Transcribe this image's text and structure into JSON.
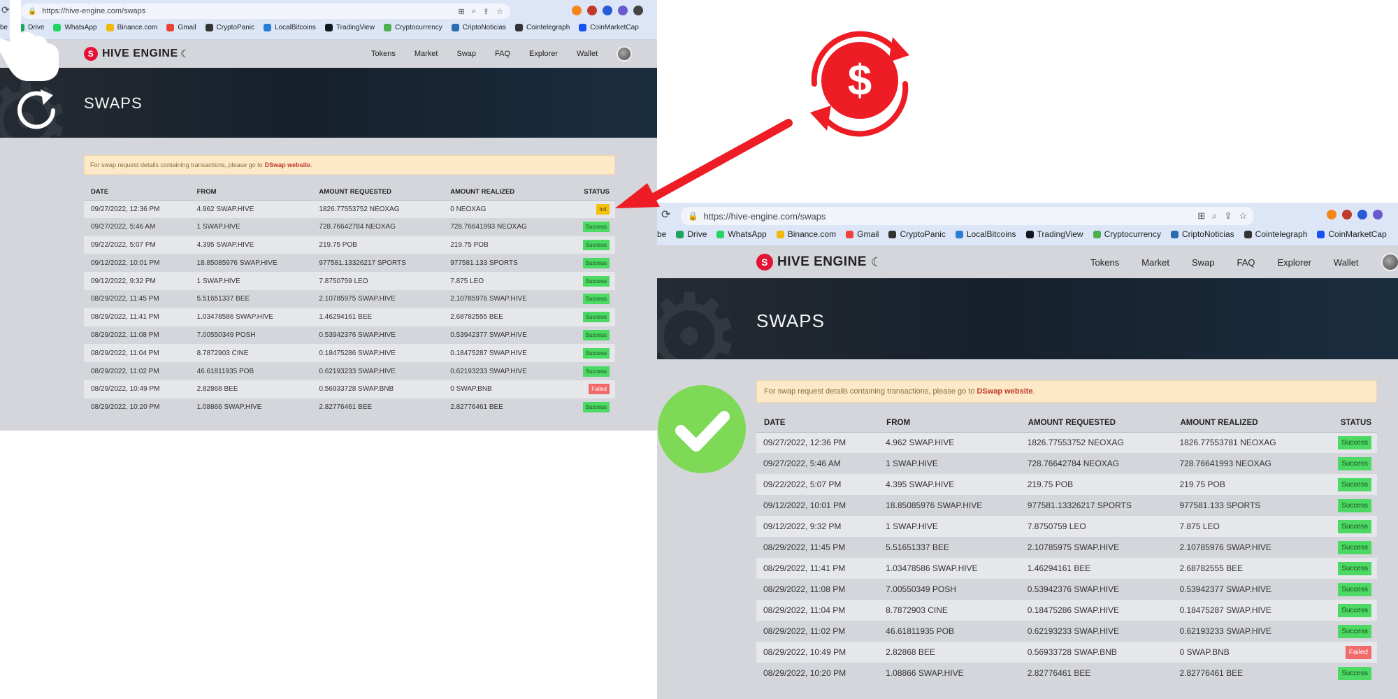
{
  "browser": {
    "url": "https://hive-engine.com/swaps",
    "bookmarks": [
      "be",
      "Drive",
      "WhatsApp",
      "Binance.com",
      "Gmail",
      "CryptoPanic",
      "LocalBitcoins",
      "TradingView",
      "Cryptocurrency",
      "CriptoNoticias",
      "Cointelegraph",
      "CoinMarketCap"
    ],
    "bookmark_colors": [
      "#ffffff",
      "#1fa463",
      "#25d366",
      "#f0b90b",
      "#ea4335",
      "#333333",
      "#2a7fd4",
      "#131722",
      "#4caf50",
      "#2b6cb0",
      "#333333",
      "#1652f0"
    ]
  },
  "site": {
    "brand": "HIVE ENGINE",
    "nav": [
      "Tokens",
      "Market",
      "Swap",
      "FAQ",
      "Explorer",
      "Wallet"
    ],
    "page_title": "SWAPS",
    "notice_text": "For swap request details containing transactions, please go to",
    "notice_link": "DSwap website",
    "notice_end": "."
  },
  "table": {
    "headers": [
      "DATE",
      "FROM",
      "AMOUNT REQUESTED",
      "AMOUNT REALIZED",
      "STATUS"
    ]
  },
  "before": {
    "rows": [
      [
        "09/27/2022, 12:36 PM",
        "4.962 SWAP.HIVE",
        "1826.77553752 NEOXAG",
        "0 NEOXAG",
        "Init"
      ],
      [
        "09/27/2022, 5:46 AM",
        "1 SWAP.HIVE",
        "728.76642784 NEOXAG",
        "728.76641993 NEOXAG",
        "Success"
      ],
      [
        "09/22/2022, 5:07 PM",
        "4.395 SWAP.HIVE",
        "219.75 POB",
        "219.75 POB",
        "Success"
      ],
      [
        "09/12/2022, 10:01 PM",
        "18.85085976 SWAP.HIVE",
        "977581.13326217 SPORTS",
        "977581.133 SPORTS",
        "Success"
      ],
      [
        "09/12/2022, 9:32 PM",
        "1 SWAP.HIVE",
        "7.8750759 LEO",
        "7.875 LEO",
        "Success"
      ],
      [
        "08/29/2022, 11:45 PM",
        "5.51651337 BEE",
        "2.10785975 SWAP.HIVE",
        "2.10785976 SWAP.HIVE",
        "Success"
      ],
      [
        "08/29/2022, 11:41 PM",
        "1.03478586 SWAP.HIVE",
        "1.46294161 BEE",
        "2.68782555 BEE",
        "Success"
      ],
      [
        "08/29/2022, 11:08 PM",
        "7.00550349 POSH",
        "0.53942376 SWAP.HIVE",
        "0.53942377 SWAP.HIVE",
        "Success"
      ],
      [
        "08/29/2022, 11:04 PM",
        "8.7872903 CINE",
        "0.18475286 SWAP.HIVE",
        "0.18475287 SWAP.HIVE",
        "Success"
      ],
      [
        "08/29/2022, 11:02 PM",
        "46.61811935 POB",
        "0.62193233 SWAP.HIVE",
        "0.62193233 SWAP.HIVE",
        "Success"
      ],
      [
        "08/29/2022, 10:49 PM",
        "2.82868 BEE",
        "0.56933728 SWAP.BNB",
        "0 SWAP.BNB",
        "Failed"
      ],
      [
        "08/29/2022, 10:20 PM",
        "1.08866 SWAP.HIVE",
        "2.82776461 BEE",
        "2.82776461 BEE",
        "Success"
      ]
    ]
  },
  "after": {
    "rows": [
      [
        "09/27/2022, 12:36 PM",
        "4.962 SWAP.HIVE",
        "1826.77553752 NEOXAG",
        "1826.77553781 NEOXAG",
        "Success"
      ],
      [
        "09/27/2022, 5:46 AM",
        "1 SWAP.HIVE",
        "728.76642784 NEOXAG",
        "728.76641993 NEOXAG",
        "Success"
      ],
      [
        "09/22/2022, 5:07 PM",
        "4.395 SWAP.HIVE",
        "219.75 POB",
        "219.75 POB",
        "Success"
      ],
      [
        "09/12/2022, 10:01 PM",
        "18.85085976 SWAP.HIVE",
        "977581.13326217 SPORTS",
        "977581.133 SPORTS",
        "Success"
      ],
      [
        "09/12/2022, 9:32 PM",
        "1 SWAP.HIVE",
        "7.8750759 LEO",
        "7.875 LEO",
        "Success"
      ],
      [
        "08/29/2022, 11:45 PM",
        "5.51651337 BEE",
        "2.10785975 SWAP.HIVE",
        "2.10785976 SWAP.HIVE",
        "Success"
      ],
      [
        "08/29/2022, 11:41 PM",
        "1.03478586 SWAP.HIVE",
        "1.46294161 BEE",
        "2.68782555 BEE",
        "Success"
      ],
      [
        "08/29/2022, 11:08 PM",
        "7.00550349 POSH",
        "0.53942376 SWAP.HIVE",
        "0.53942377 SWAP.HIVE",
        "Success"
      ],
      [
        "08/29/2022, 11:04 PM",
        "8.7872903 CINE",
        "0.18475286 SWAP.HIVE",
        "0.18475287 SWAP.HIVE",
        "Success"
      ],
      [
        "08/29/2022, 11:02 PM",
        "46.61811935 POB",
        "0.62193233 SWAP.HIVE",
        "0.62193233 SWAP.HIVE",
        "Success"
      ],
      [
        "08/29/2022, 10:49 PM",
        "2.82868 BEE",
        "0.56933728 SWAP.BNB",
        "0 SWAP.BNB",
        "Failed"
      ],
      [
        "08/29/2022, 10:20 PM",
        "1.08866 SWAP.HIVE",
        "2.82776461 BEE",
        "2.82776461 BEE",
        "Success"
      ]
    ]
  },
  "overlay": {
    "swap_symbol": "$",
    "colors": {
      "swap_red": "#ee1c24",
      "check_green": "#7ed957",
      "hive_red": "#e31337",
      "success_green": "#4cd964",
      "failed_red": "#f16a6a",
      "init_yellow": "#f4c20d"
    },
    "icons": [
      "hand-pointer-icon",
      "refresh-icon",
      "dollar-swap-icon",
      "checkmark-icon",
      "arrow-icon"
    ]
  }
}
